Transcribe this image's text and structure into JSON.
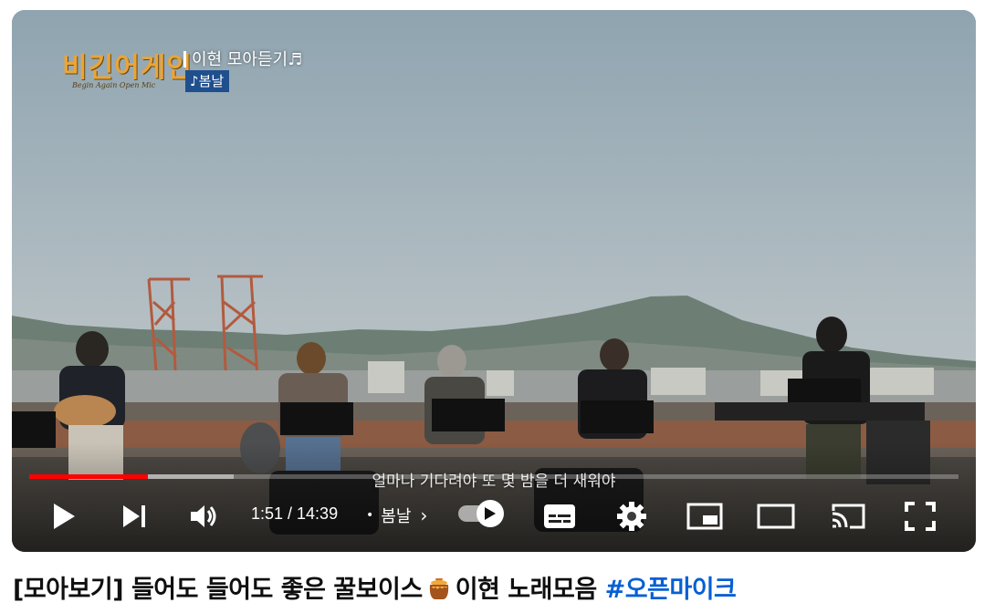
{
  "video": {
    "show_logo": "비긴어게인",
    "show_logo_sub": "Begin Again Open Mic",
    "caption_title": "이현 모아듣기♬",
    "caption_song": "♪봄날",
    "subtitle": "얼마나 기다려야 또 몇 밤을 더 새워야"
  },
  "player": {
    "progress_played_fraction": 0.128,
    "time_display": "1:51 / 14:39",
    "chapter_name": "봄날",
    "autoplay_on": true,
    "accent_color": "#ff0000",
    "controls": {
      "play": "play-icon",
      "next": "next-icon",
      "volume": "volume-icon",
      "autoplay": "autoplay-toggle",
      "subtitles": "subtitles-icon",
      "settings": "gear-icon",
      "miniplayer": "miniplayer-icon",
      "theater": "theater-mode-icon",
      "cast": "cast-icon",
      "fullscreen": "fullscreen-icon"
    }
  },
  "title": {
    "main": "[모아보기] 들어도 들어도 좋은 꿀보이스",
    "icon": "honey-pot-icon",
    "after_icon": "이현 노래모음",
    "hashtag": "#오픈마이크"
  }
}
